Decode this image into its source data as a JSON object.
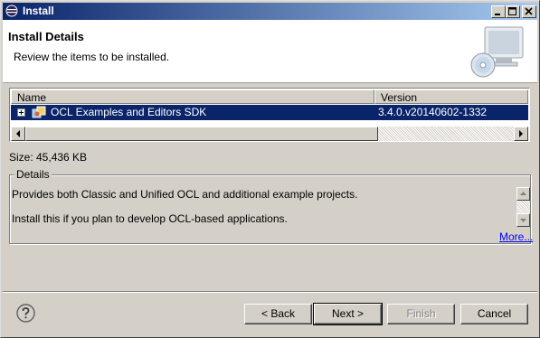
{
  "window": {
    "title": "Install"
  },
  "titlebar_buttons": [
    "minimize-icon",
    "maximize-icon",
    "close-icon"
  ],
  "header": {
    "title": "Install Details",
    "description": "Review the items to be installed."
  },
  "table": {
    "columns": [
      "Name",
      "Version"
    ],
    "rows": [
      {
        "name": "OCL Examples and Editors SDK",
        "version": "3.4.0.v20140602-1332",
        "selected": true,
        "icon": "feature-icon"
      }
    ]
  },
  "size_label": "Size: 45,436 KB",
  "details": {
    "legend": "Details",
    "paragraphs": [
      "Provides both Classic and Unified OCL and additional example projects.",
      "Install this if you plan to develop OCL-based applications."
    ],
    "more_link": "More..."
  },
  "buttons": {
    "back": "< Back",
    "next": "Next >",
    "finish": "Finish",
    "cancel": "Cancel"
  },
  "colors": {
    "selection": "#0a246a",
    "link": "#0000ff",
    "face": "#d4d0c8"
  }
}
